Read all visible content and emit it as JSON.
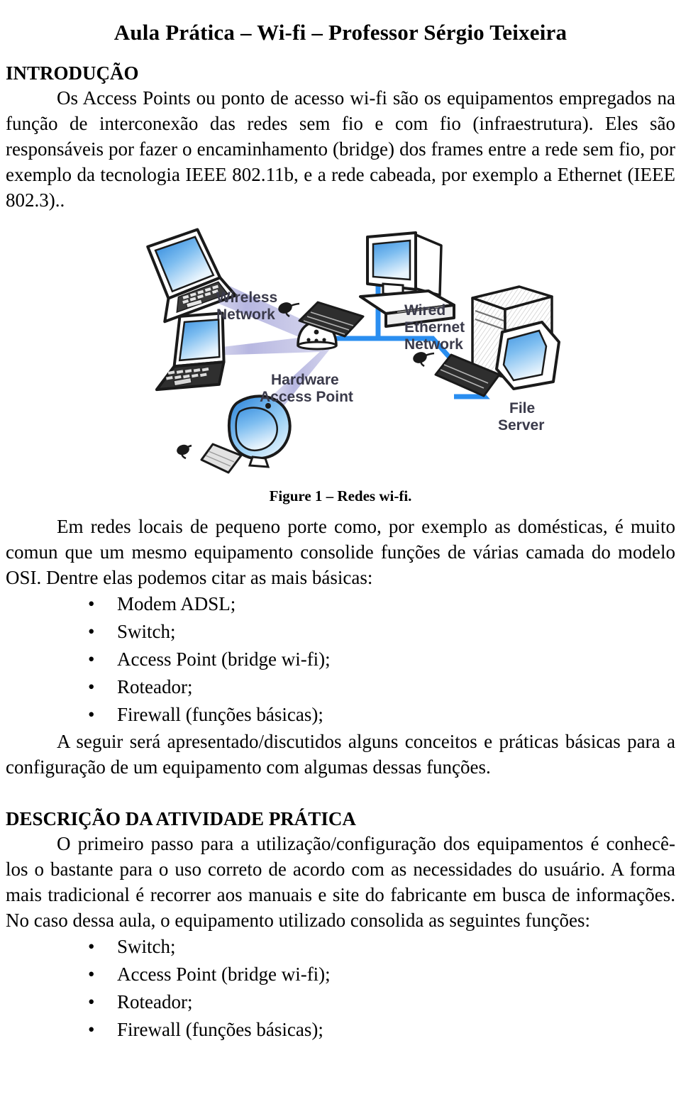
{
  "document": {
    "title": "Aula Prática – Wi-fi – Professor Sérgio Teixeira"
  },
  "intro": {
    "heading": "INTRODUÇÃO",
    "paragraph": "Os Access Points ou ponto de acesso wi-fi são os equipamentos empregados na função de interconexão das redes sem fio e com fio (infraestrutura). Eles são responsáveis por fazer o encaminhamento (bridge) dos frames entre a rede sem fio, por exemplo da tecnologia IEEE 802.11b, e a rede cabeada, por exemplo a Ethernet (IEEE 802.3).."
  },
  "figure": {
    "caption": "Figure 1 – Redes wi-fi.",
    "labels": {
      "wireless_network_line1": "Wireless",
      "wireless_network_line2": "Network",
      "wired_line1": "Wired",
      "wired_line2": "Ethernet",
      "wired_line3": "Network",
      "access_point_line1": "Hardware",
      "access_point_line2": "Access Point",
      "file_server_line1": "File",
      "file_server_line2": "Server"
    },
    "colors": {
      "ethernet_link": "#2a8ef0",
      "wireless_beam": "#b9b9e2",
      "screen_blue_light": "#bfe2fb",
      "screen_blue_dark": "#1f7fd6",
      "outline": "#1a1a1a",
      "device_body": "#ffffff",
      "device_shade": "#d9d9d9",
      "label_text": "#333344"
    }
  },
  "body_section": {
    "paragraph_intro": "Em redes locais de pequeno porte como, por exemplo as domésticas, é muito comun que um mesmo equipamento consolide funções de várias camada do modelo OSI. Dentre elas podemos citar as mais básicas:",
    "bullet_marker": "•",
    "functions_list": [
      "Modem ADSL;",
      "Switch;",
      "Access Point (bridge wi-fi);",
      "Roteador;",
      "Firewall (funções básicas);"
    ],
    "paragraph_after": "A seguir será apresentado/discutidos alguns conceitos e práticas básicas para a configuração de um equipamento com algumas dessas funções."
  },
  "practice_section": {
    "heading": "DESCRIÇÃO DA ATIVIDADE PRÁTICA",
    "paragraph": "O primeiro passo para a utilização/configuração dos equipamentos é conhecê-los o bastante para o uso correto de acordo com as necessidades do usuário. A forma mais tradicional é recorrer aos manuais e site do fabricante em busca de informações. No caso dessa aula, o equipamento utilizado consolida as seguintes funções:",
    "bullet_marker": "•",
    "functions_list": [
      "Switch;",
      "Access Point (bridge wi-fi);",
      "Roteador;",
      "Firewall (funções básicas);"
    ]
  }
}
